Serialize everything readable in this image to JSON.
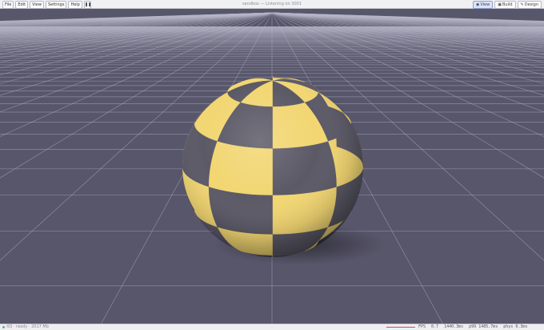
{
  "menu": {
    "items": [
      {
        "label": "File"
      },
      {
        "label": "Edit"
      },
      {
        "label": "View"
      },
      {
        "label": "Settings"
      },
      {
        "label": "Help"
      }
    ],
    "pause_symbol": "❚❚"
  },
  "window": {
    "title": "sandbox — Listening on 3001"
  },
  "modes": {
    "tabs": [
      {
        "label": "View",
        "icon": "eye-icon",
        "glyph": "◉",
        "active": true
      },
      {
        "label": "Build",
        "icon": "build-icon",
        "glyph": "▣",
        "active": false
      },
      {
        "label": "Design",
        "icon": "design-icon",
        "glyph": "✎",
        "active": false
      }
    ]
  },
  "scene": {
    "background_color": "#58566a",
    "grid_color": "#b8b6c8",
    "checker_colors": [
      "#f2d672",
      "#5b5966"
    ]
  },
  "status": {
    "left_text": "XQ · ready · 2017 Mb",
    "fps_label": "FPS",
    "fps_value": "0.7",
    "frame_time": "1440.3ms",
    "p99": "p99 1485.7ms",
    "phys": "phys  0.3ms",
    "fps_bar_color": "#e04848"
  }
}
